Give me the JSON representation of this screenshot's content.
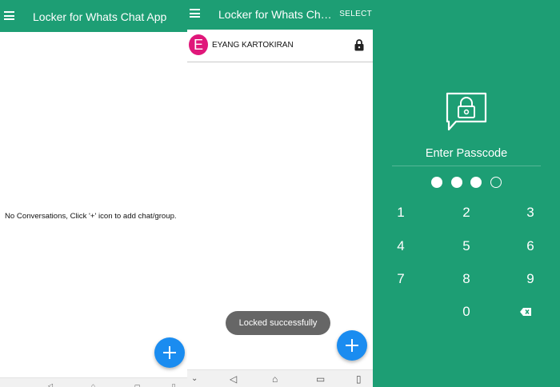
{
  "left_screen": {
    "title": "Locker for Whats Chat App",
    "empty_message": "No Conversations, Click '+' icon to add chat/group."
  },
  "middle_screen": {
    "title": "Locker for Whats Chat App",
    "select_label": "SELECT",
    "chat": {
      "avatar_letter": "E",
      "name": "EYANG KARTOKIRAN",
      "locked": true
    },
    "toast": "Locked successfully"
  },
  "right_screen": {
    "prompt": "Enter Passcode",
    "passcode_length": 4,
    "digits_entered": 3,
    "keypad": [
      "1",
      "2",
      "3",
      "4",
      "5",
      "6",
      "7",
      "8",
      "9",
      "0"
    ]
  },
  "colors": {
    "app_green": "#1d9e74",
    "fab_blue": "#1a8cf0",
    "avatar_pink": "#e0177a",
    "toast_grey": "#666666"
  },
  "icons": [
    "menu-icon",
    "lock-icon",
    "plus-icon",
    "backspace-icon",
    "chat-lock-icon",
    "back-nav-icon",
    "home-nav-icon",
    "recents-nav-icon"
  ]
}
